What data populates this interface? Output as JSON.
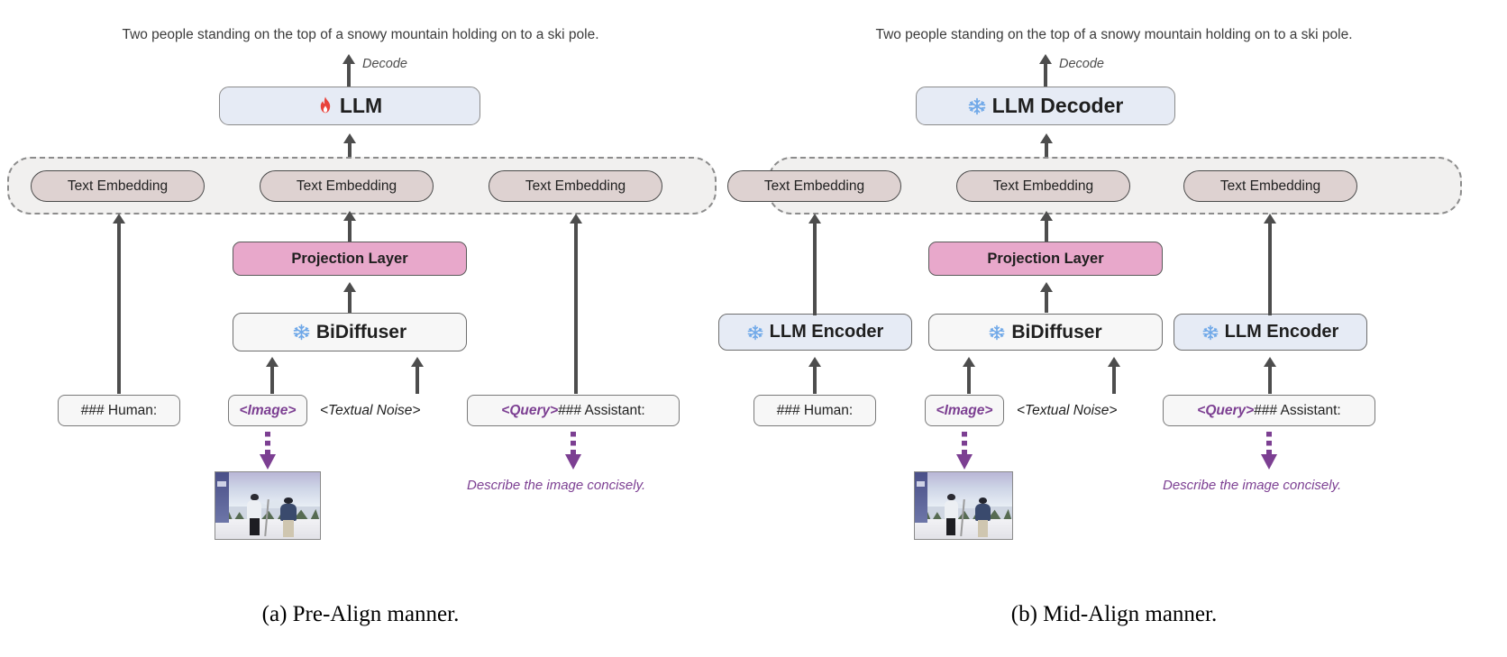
{
  "figure": {
    "panels": [
      {
        "id": "a",
        "sub_caption": "(a) Pre-Align manner.",
        "top_caption": "Two people standing on the top of a snowy mountain holding on to a ski pole.",
        "decode_label": "Decode",
        "llm_box": {
          "label": "LLM",
          "icon": "fire-icon",
          "state": "trainable"
        },
        "embeddings": [
          {
            "label": "Text Embedding"
          },
          {
            "label": "Text Embedding"
          },
          {
            "label": "Text Embedding"
          }
        ],
        "projection_layer": {
          "label": "Projection Layer"
        },
        "encoder_boxes": [
          {
            "label": "BiDiffuser",
            "icon": "snowflake-icon",
            "state": "frozen"
          }
        ],
        "tokens": [
          {
            "type": "boxed",
            "plain": "### Human:",
            "purple": ""
          },
          {
            "type": "boxed",
            "plain": "",
            "purple": "<Image>"
          },
          {
            "type": "free",
            "plain": "<Textual Noise>",
            "purple": ""
          },
          {
            "type": "boxed",
            "plain": " ### Assistant:",
            "purple": "<Query>"
          }
        ],
        "image_note": "skiers-photo",
        "query_note": "Describe the image concisely."
      },
      {
        "id": "b",
        "sub_caption": "(b) Mid-Align manner.",
        "top_caption": "Two people standing on the top of a snowy mountain holding on to a ski pole.",
        "decode_label": "Decode",
        "llm_box": {
          "label": "LLM Decoder",
          "icon": "snowflake-icon",
          "state": "frozen"
        },
        "embeddings": [
          {
            "label": "Text Embedding"
          },
          {
            "label": "Text Embedding"
          },
          {
            "label": "Text Embedding"
          }
        ],
        "projection_layer": {
          "label": "Projection Layer"
        },
        "encoder_boxes": [
          {
            "label": "LLM Encoder",
            "icon": "snowflake-icon",
            "state": "frozen"
          },
          {
            "label": "BiDiffuser",
            "icon": "snowflake-icon",
            "state": "frozen"
          },
          {
            "label": "LLM Encoder",
            "icon": "snowflake-icon",
            "state": "frozen"
          }
        ],
        "tokens": [
          {
            "type": "boxed",
            "plain": "### Human:",
            "purple": ""
          },
          {
            "type": "boxed",
            "plain": "",
            "purple": "<Image>"
          },
          {
            "type": "free",
            "plain": "<Textual Noise>",
            "purple": ""
          },
          {
            "type": "boxed",
            "plain": " ### Assistant:",
            "purple": "<Query>"
          }
        ],
        "image_note": "skiers-photo",
        "query_note": "Describe the image concisely."
      }
    ]
  },
  "colors": {
    "llm_box_fill": "#e6ebf5",
    "embedding_pill_fill": "#ded2d1",
    "embedding_container_fill": "#f1f0ef",
    "projection_fill": "#e8a8cb",
    "bidiffuser_fill": "#f7f7f7",
    "token_fill": "#f7f7f7",
    "purple_accent": "#7c3f92",
    "arrow_grey": "#4d4d4d",
    "snowflake_blue": "#6fa8e8",
    "fire_red": "#e8433c"
  }
}
